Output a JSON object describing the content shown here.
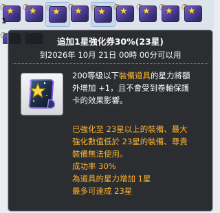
{
  "inventory": {
    "top_slots": [
      {
        "qty": "1",
        "selected": false
      },
      {
        "qty": "",
        "selected": false
      },
      {
        "qty": "",
        "selected": true
      },
      {
        "qty": "",
        "selected": false
      },
      {
        "qty": "",
        "selected": true
      },
      {
        "qty": "",
        "selected": false
      },
      {
        "qty": "",
        "selected": false
      },
      {
        "qty": "",
        "selected": false
      },
      {
        "qty": "",
        "selected": false
      }
    ]
  },
  "tooltip": {
    "title": "追加1星強化券30%(23星)",
    "expire": "到2026年 10月 21日 00時 00分可以用",
    "desc_lines": [
      {
        "parts": [
          {
            "text": "200等級以下",
            "hl": false
          },
          {
            "text": "裝備道具",
            "hl": true
          },
          {
            "text": "的星力將額",
            "hl": false
          }
        ]
      },
      {
        "parts": [
          {
            "text": "外增加 +1，且不會受到卷軸保護",
            "hl": false
          }
        ]
      },
      {
        "parts": [
          {
            "text": "卡的效果影響。",
            "hl": false
          }
        ]
      }
    ],
    "warn_lines": [
      "已強化至 23星以上的裝備、最大",
      "強化數值低於 23星的裝備、尊貴",
      "裝備無法使用。",
      "成功率 30%",
      "為道具的星力增加 1星",
      "最多可達成 23星"
    ],
    "colors": {
      "highlight": "#ffb52e",
      "text": "#ffffff",
      "background": "#1c1e22"
    },
    "icon": "star-force-scroll-icon"
  }
}
